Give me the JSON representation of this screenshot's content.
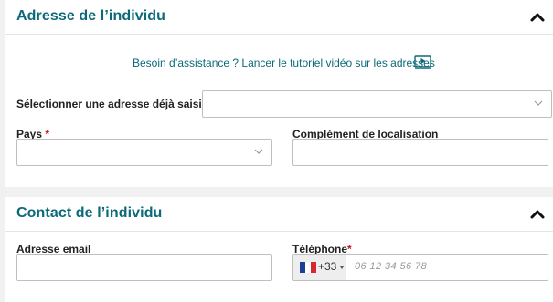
{
  "address_section": {
    "title": "Adresse de l’individu",
    "help_link": "Besoin d’assistance ? Lancer le tutoriel vidéo sur les adresses",
    "existing_address_label": "Sélectionner une adresse déjà saisie :",
    "existing_address_value": "",
    "country_label": "Pays",
    "country_required_marker": "*",
    "country_value": "",
    "location_complement_label": "Complément de localisation",
    "location_complement_value": ""
  },
  "contact_section": {
    "title": "Contact de l’individu",
    "email_label": "Adresse email",
    "email_value": "",
    "phone_label": "Téléphone",
    "phone_required_marker": "*",
    "phone_country_code": "+33",
    "phone_placeholder": "06 12 34 56 78",
    "phone_value": ""
  },
  "colors": {
    "accent": "#0b6a7a",
    "required": "#c0151d",
    "background": "#f1f1f1"
  },
  "icons": {
    "collapse": "chevron-up-icon",
    "video": "video-play-icon",
    "dropdown": "chevron-down-icon",
    "flag": "france-flag-icon"
  }
}
